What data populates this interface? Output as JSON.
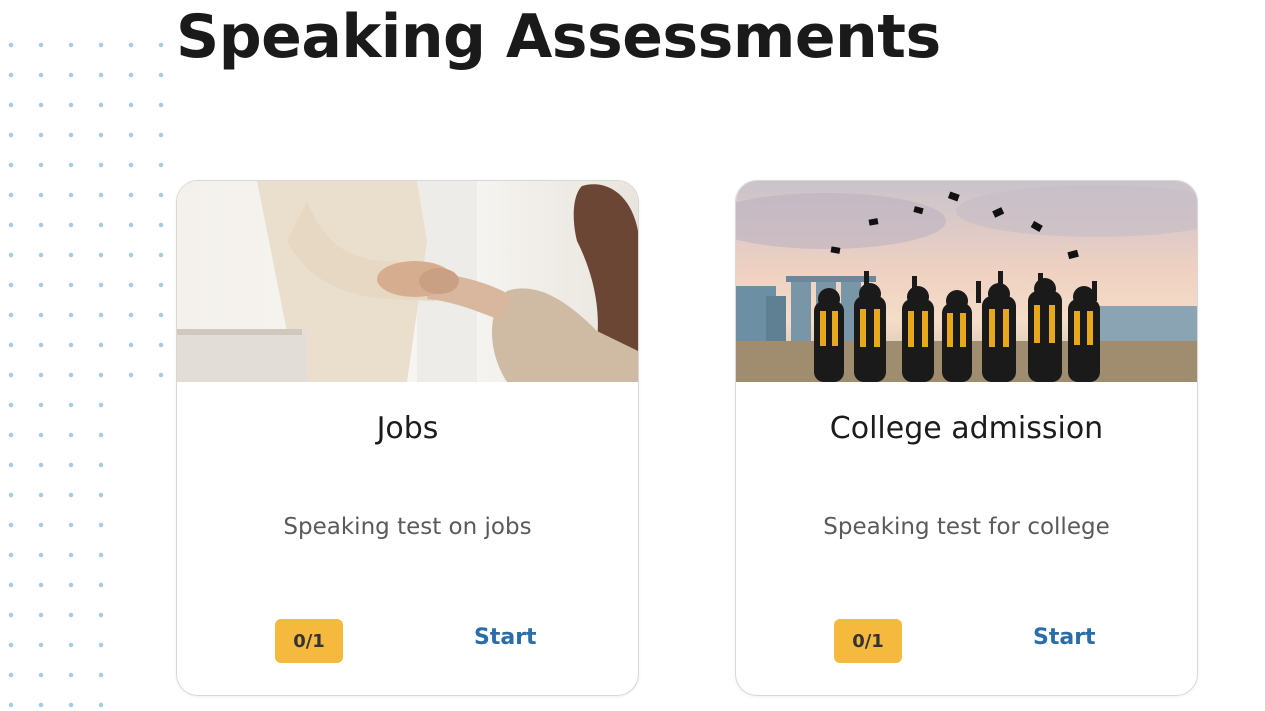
{
  "page": {
    "title": "Speaking Assessments"
  },
  "cards": [
    {
      "title": "Jobs",
      "description": "Speaking test on jobs",
      "progress": "0/1",
      "action_label": "Start",
      "image": "handshake-photo"
    },
    {
      "title": "College admission",
      "description": "Speaking test for college",
      "progress": "0/1",
      "action_label": "Start",
      "image": "graduation-photo"
    }
  ],
  "colors": {
    "badge": "#f5b93e",
    "link": "#2a6da8",
    "dots": "#a9cbe2"
  }
}
